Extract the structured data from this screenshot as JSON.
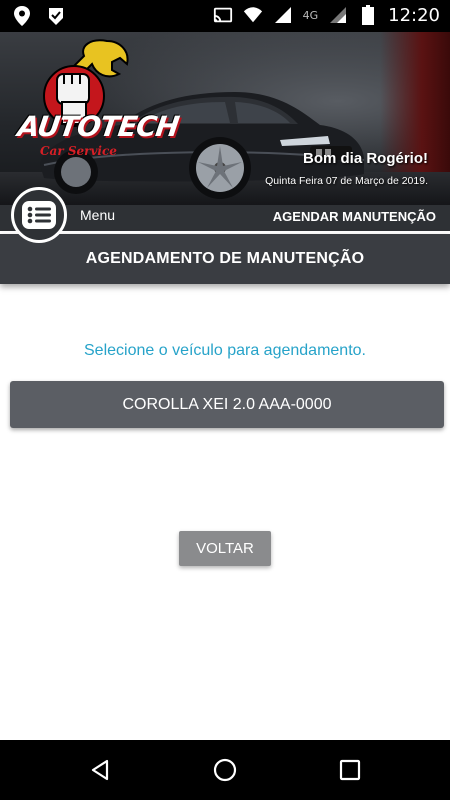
{
  "status_bar": {
    "time": "12:20",
    "network": "4G",
    "icons": [
      "location-pin-icon",
      "navigation-check-icon",
      "cast-icon",
      "wifi-icon",
      "signal-icon",
      "signal-icon",
      "battery-icon"
    ]
  },
  "banner": {
    "logo_text": "AUTOTECH",
    "logo_subtitle": "Car Service",
    "greeting": "Bom dia Rogério!",
    "date": "Quinta Feira 07 de Março de 2019."
  },
  "menu": {
    "icon": "list-menu-icon",
    "label": "Menu",
    "action_label": "AGENDAR MANUTENÇÃO"
  },
  "page": {
    "title": "AGENDAMENTO DE MANUTENÇÃO",
    "prompt": "Selecione o veículo para agendamento.",
    "vehicles": [
      "COROLLA XEI 2.0 AAA-0000"
    ],
    "back_label": "VOLTAR"
  },
  "nav_bar": {
    "icons": [
      "back-triangle-icon",
      "home-circle-icon",
      "recents-square-icon"
    ]
  },
  "colors": {
    "accent": "#27a3c9",
    "header_bg": "#3a3d42",
    "vehicle_button": "#5b5e64",
    "back_button": "#8a8b8d",
    "logo_red": "#d81f26"
  }
}
